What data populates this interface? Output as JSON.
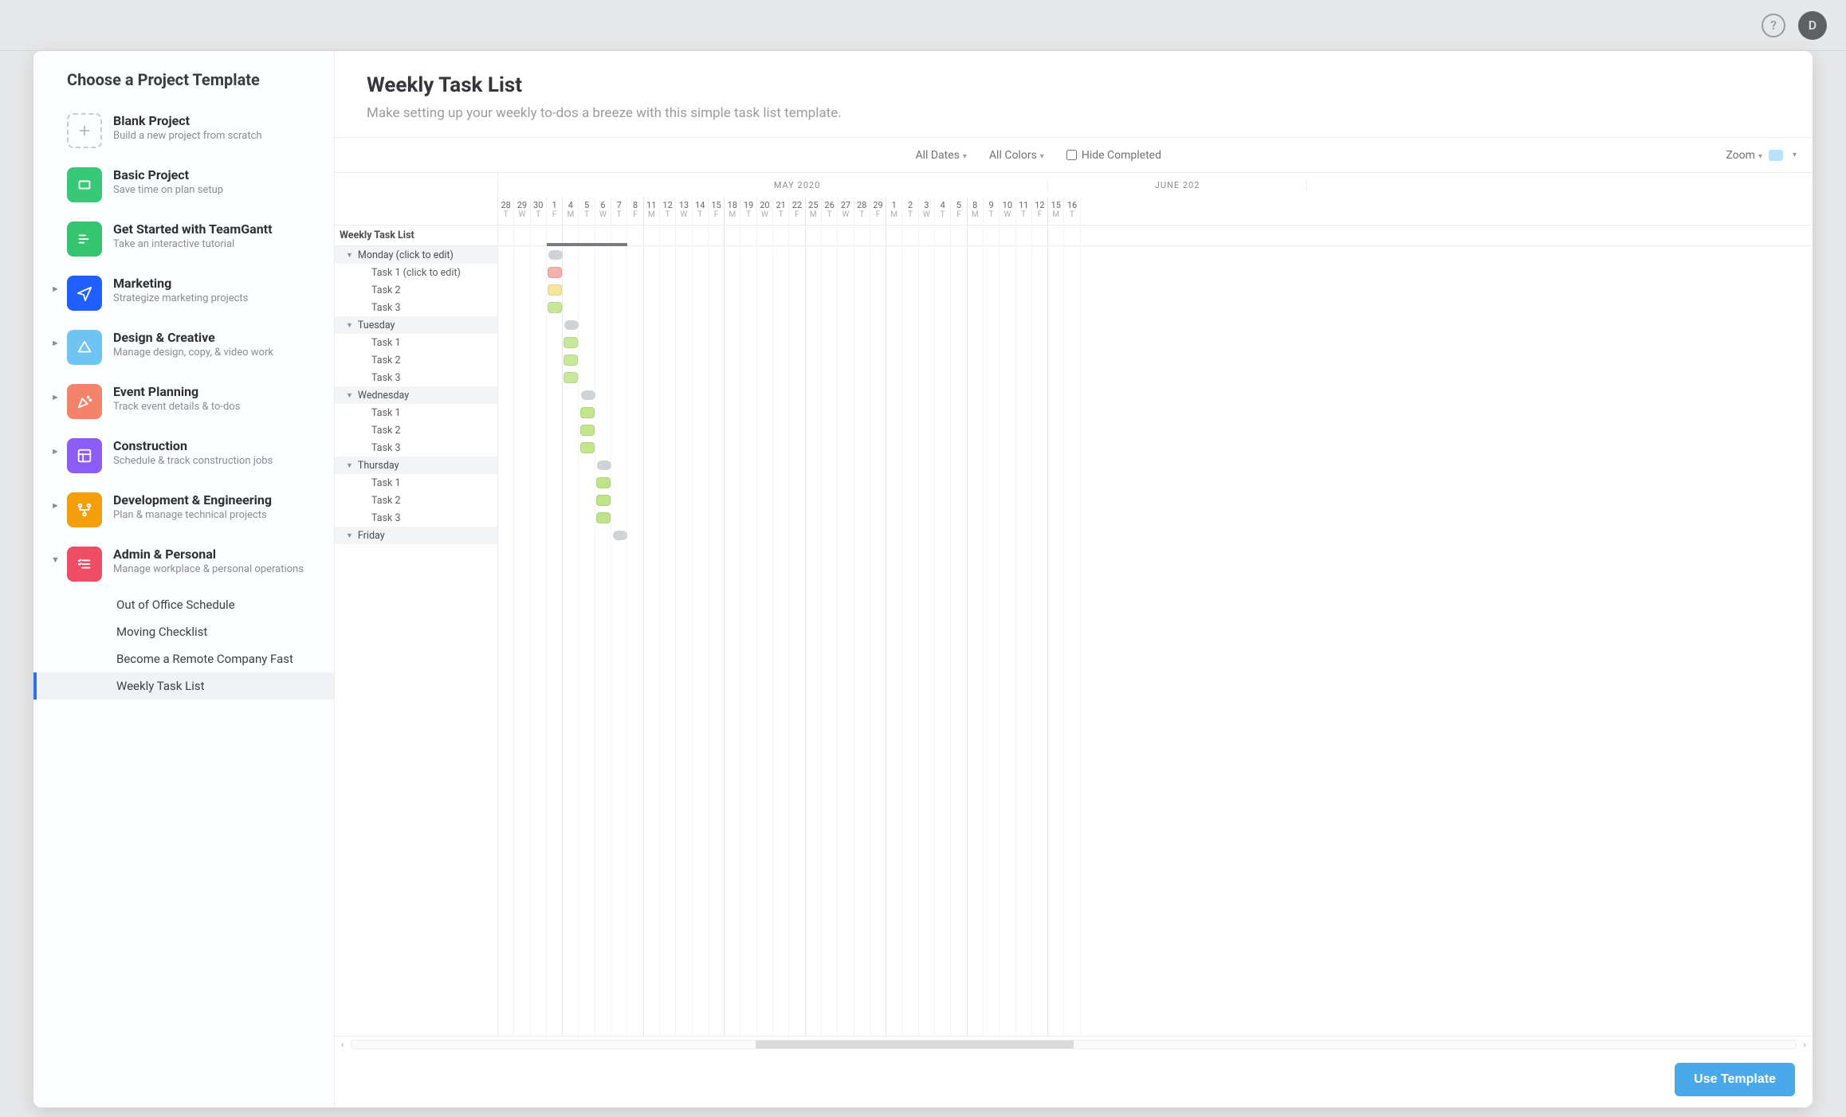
{
  "topbar": {
    "help_glyph": "?",
    "avatar_letter": "D"
  },
  "sidebar": {
    "heading": "Choose a Project Template",
    "templates": [
      {
        "title": "Blank Project",
        "sub": "Build a new project from scratch",
        "icon": "plus",
        "iconClass": "dashed",
        "chev": ""
      },
      {
        "title": "Basic Project",
        "sub": "Save time on plan setup",
        "icon": "rect",
        "iconClass": "bg-green",
        "chev": ""
      },
      {
        "title": "Get Started with TeamGantt",
        "sub": "Take an interactive tutorial",
        "icon": "bars",
        "iconClass": "bg-green2",
        "chev": ""
      },
      {
        "title": "Marketing",
        "sub": "Strategize marketing projects",
        "icon": "plane",
        "iconClass": "bg-blue",
        "chev": "►"
      },
      {
        "title": "Design & Creative",
        "sub": "Manage design, copy, & video work",
        "icon": "tri",
        "iconClass": "bg-sky",
        "chev": "►"
      },
      {
        "title": "Event Planning",
        "sub": "Track event details & to-dos",
        "icon": "confetti",
        "iconClass": "bg-coral",
        "chev": "►"
      },
      {
        "title": "Construction",
        "sub": "Schedule & track construction jobs",
        "icon": "blueprint",
        "iconClass": "bg-purple",
        "chev": "►"
      },
      {
        "title": "Development & Engineering",
        "sub": "Plan & manage technical projects",
        "icon": "flow",
        "iconClass": "bg-orange",
        "chev": "►"
      },
      {
        "title": "Admin & Personal",
        "sub": "Manage workplace & personal operations",
        "icon": "checklist",
        "iconClass": "bg-red",
        "chev": "▼"
      }
    ],
    "sub_templates": [
      {
        "label": "Out of Office Schedule",
        "active": false
      },
      {
        "label": "Moving Checklist",
        "active": false
      },
      {
        "label": "Become a Remote Company Fast",
        "active": false
      },
      {
        "label": "Weekly Task List",
        "active": true
      }
    ]
  },
  "main": {
    "title": "Weekly Task List",
    "description": "Make setting up your weekly to-dos a breeze with this simple task list template."
  },
  "filters": {
    "dates": "All Dates",
    "colors": "All Colors",
    "hide_completed": "Hide Completed",
    "zoom": "Zoom"
  },
  "timeline": {
    "months": [
      {
        "label": "",
        "span_days": 3
      },
      {
        "label": "MAY 2020",
        "span_days": 31
      },
      {
        "label": "JUNE 202",
        "span_days": 16
      }
    ],
    "days": [
      {
        "n": "28",
        "d": "T"
      },
      {
        "n": "29",
        "d": "W"
      },
      {
        "n": "30",
        "d": "T"
      },
      {
        "n": "1",
        "d": "F"
      },
      {
        "n": "4",
        "d": "M"
      },
      {
        "n": "5",
        "d": "T"
      },
      {
        "n": "6",
        "d": "W"
      },
      {
        "n": "7",
        "d": "T"
      },
      {
        "n": "8",
        "d": "F"
      },
      {
        "n": "11",
        "d": "M"
      },
      {
        "n": "12",
        "d": "T"
      },
      {
        "n": "13",
        "d": "W"
      },
      {
        "n": "14",
        "d": "T"
      },
      {
        "n": "15",
        "d": "F"
      },
      {
        "n": "18",
        "d": "M"
      },
      {
        "n": "19",
        "d": "T"
      },
      {
        "n": "20",
        "d": "W"
      },
      {
        "n": "21",
        "d": "T"
      },
      {
        "n": "22",
        "d": "F"
      },
      {
        "n": "25",
        "d": "M"
      },
      {
        "n": "26",
        "d": "T"
      },
      {
        "n": "27",
        "d": "W"
      },
      {
        "n": "28",
        "d": "T"
      },
      {
        "n": "29",
        "d": "F"
      },
      {
        "n": "1",
        "d": "M"
      },
      {
        "n": "2",
        "d": "T"
      },
      {
        "n": "3",
        "d": "W"
      },
      {
        "n": "4",
        "d": "T"
      },
      {
        "n": "5",
        "d": "F"
      },
      {
        "n": "8",
        "d": "M"
      },
      {
        "n": "9",
        "d": "T"
      },
      {
        "n": "10",
        "d": "W"
      },
      {
        "n": "11",
        "d": "T"
      },
      {
        "n": "12",
        "d": "F"
      },
      {
        "n": "15",
        "d": "M"
      },
      {
        "n": "16",
        "d": "T"
      }
    ]
  },
  "gantt": {
    "project_name": "Weekly Task List",
    "groups": [
      {
        "name": "Monday (click to edit)",
        "pill_start": 4,
        "pill_span": 1,
        "tasks": [
          {
            "name": "Task 1 (click to edit)",
            "start": 4,
            "span": 1,
            "color": "c-red"
          },
          {
            "name": "Task 2",
            "start": 4,
            "span": 1,
            "color": "c-yellow"
          },
          {
            "name": "Task 3",
            "start": 4,
            "span": 1,
            "color": "c-green"
          }
        ]
      },
      {
        "name": "Tuesday",
        "pill_start": 5,
        "pill_span": 1,
        "tasks": [
          {
            "name": "Task 1",
            "start": 5,
            "span": 1,
            "color": "c-green"
          },
          {
            "name": "Task 2",
            "start": 5,
            "span": 1,
            "color": "c-green"
          },
          {
            "name": "Task 3",
            "start": 5,
            "span": 1,
            "color": "c-green"
          }
        ]
      },
      {
        "name": "Wednesday",
        "pill_start": 6,
        "pill_span": 1,
        "tasks": [
          {
            "name": "Task 1",
            "start": 6,
            "span": 1,
            "color": "c-green2"
          },
          {
            "name": "Task 2",
            "start": 6,
            "span": 1,
            "color": "c-green2"
          },
          {
            "name": "Task 3",
            "start": 6,
            "span": 1,
            "color": "c-green2"
          }
        ]
      },
      {
        "name": "Thursday",
        "pill_start": 7,
        "pill_span": 1,
        "tasks": [
          {
            "name": "Task 1",
            "start": 7,
            "span": 1,
            "color": "c-green3"
          },
          {
            "name": "Task 2",
            "start": 7,
            "span": 1,
            "color": "c-green3"
          },
          {
            "name": "Task 3",
            "start": 7,
            "span": 1,
            "color": "c-green3"
          }
        ]
      },
      {
        "name": "Friday",
        "pill_start": 8,
        "pill_span": 1,
        "tasks": []
      }
    ],
    "progress": {
      "start": 4,
      "span": 5
    }
  },
  "footer": {
    "use_template": "Use Template"
  }
}
